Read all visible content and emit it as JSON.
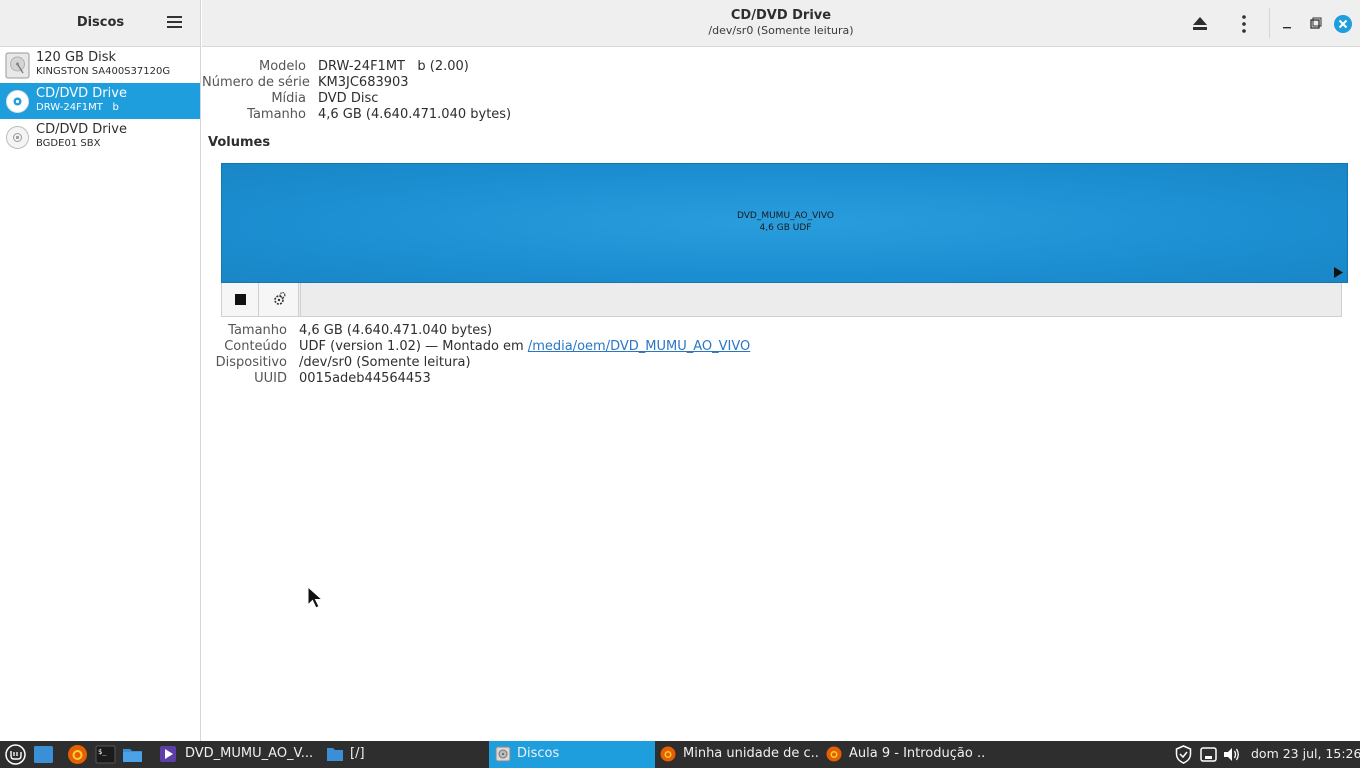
{
  "sidebar": {
    "title": "Discos",
    "items": [
      {
        "name": "120 GB Disk",
        "sub": "KINGSTON SA400S37120G",
        "icon": "hard-disk-icon"
      },
      {
        "name": "CD/DVD Drive",
        "sub": "DRW-24F1MT   b",
        "icon": "optical-disc-icon",
        "selected": true
      },
      {
        "name": "CD/DVD Drive",
        "sub": "BGDE01 SBX",
        "icon": "optical-disc-icon"
      }
    ]
  },
  "header": {
    "title": "CD/DVD Drive",
    "subtitle": "/dev/sr0 (Somente leitura)"
  },
  "drive": {
    "model_label": "Modelo",
    "model_value": "DRW-24F1MT   b (2.00)",
    "serial_label": "Número de série",
    "serial_value": "KM3JC683903",
    "media_label": "Mídia",
    "media_value": "DVD Disc",
    "size_label": "Tamanho",
    "size_value": "4,6 GB (4.640.471.040 bytes)"
  },
  "volumes": {
    "heading": "Volumes",
    "partition_name": "DVD_MUMU_AO_VIVO",
    "partition_size": "4,6 GB UDF"
  },
  "volume_details": {
    "size_label": "Tamanho",
    "size_value": "4,6 GB (4.640.471.040 bytes)",
    "content_label": "Conteúdo",
    "content_prefix": "UDF (version 1.02) — Montado em ",
    "content_link": "/media/oem/DVD_MUMU_AO_VIVO",
    "device_label": "Dispositivo",
    "device_value": "/dev/sr0 (Somente leitura)",
    "uuid_label": "UUID",
    "uuid_value": "0015adeb44564453"
  },
  "taskbar": {
    "tasks": [
      {
        "label": "DVD_MUMU_AO_V...",
        "icon": "video-icon"
      },
      {
        "label": "[/]",
        "icon": "folder-icon"
      },
      {
        "label": "Discos",
        "icon": "disks-icon",
        "active": true
      },
      {
        "label": "Minha unidade de c...",
        "icon": "firefox-icon"
      },
      {
        "label": "Aula 9 - Introdução ...",
        "icon": "firefox-icon"
      }
    ],
    "clock": "dom 23 jul, 15:26"
  },
  "colors": {
    "selection": "#1f9ede",
    "volume": "#1b8fd2",
    "taskbar": "#2e2e2e",
    "link": "#2a76c6",
    "close": "#1f9ede"
  }
}
